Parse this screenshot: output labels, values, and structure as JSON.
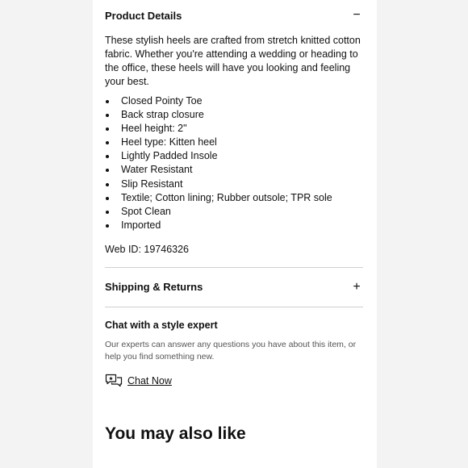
{
  "product_details": {
    "title": "Product Details",
    "toggle": "−",
    "description": "These stylish heels are crafted from stretch knitted cotton fabric. Whether you're attending a wedding or heading to the office, these heels will have you looking and feeling your best.",
    "features": [
      "Closed Pointy Toe",
      "Back strap closure",
      "Heel height: 2\"",
      "Heel type: Kitten heel",
      "Lightly Padded Insole",
      "Water Resistant",
      "Slip Resistant",
      "Textile; Cotton lining; Rubber outsole; TPR sole",
      "Spot Clean",
      "Imported"
    ],
    "web_id": "Web ID: 19746326"
  },
  "shipping": {
    "title": "Shipping & Returns",
    "toggle": "+"
  },
  "chat": {
    "title": "Chat with a style expert",
    "description": "Our experts can answer any questions you have about this item, or help you find something new.",
    "link_label": "Chat Now",
    "icon": "chat-bubbles-icon"
  },
  "recommendations": {
    "heading": "You may also like"
  }
}
